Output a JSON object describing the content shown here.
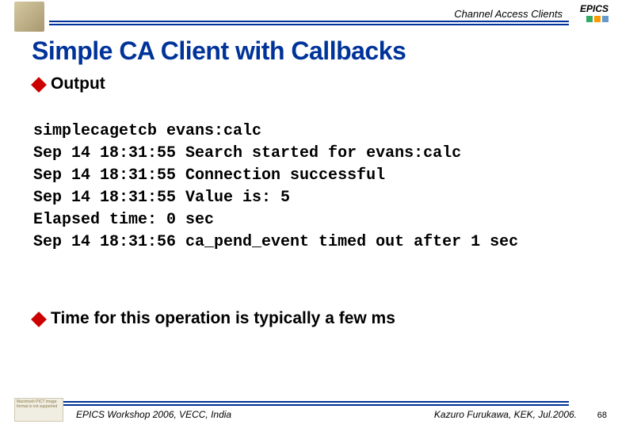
{
  "header": {
    "subject": "Channel Access Clients",
    "logo_text": "EPICS"
  },
  "title": "Simple CA Client with Callbacks",
  "bullets": {
    "b1": "Output",
    "b2": "Time for this operation is typically a few ms"
  },
  "code": "simplecagetcb evans:calc\nSep 14 18:31:55 Search started for evans:calc\nSep 14 18:31:55 Connection successful\nSep 14 18:31:55 Value is: 5\nElapsed time: 0 sec\nSep 14 18:31:56 ca_pend_event timed out after 1 sec",
  "footer": {
    "left": "EPICS Workshop 2006, VECC, India",
    "right": "Kazuro Furukawa, KEK, Jul.2006.",
    "page": "68",
    "badge": "Macintosh PICT image format is not supported"
  }
}
